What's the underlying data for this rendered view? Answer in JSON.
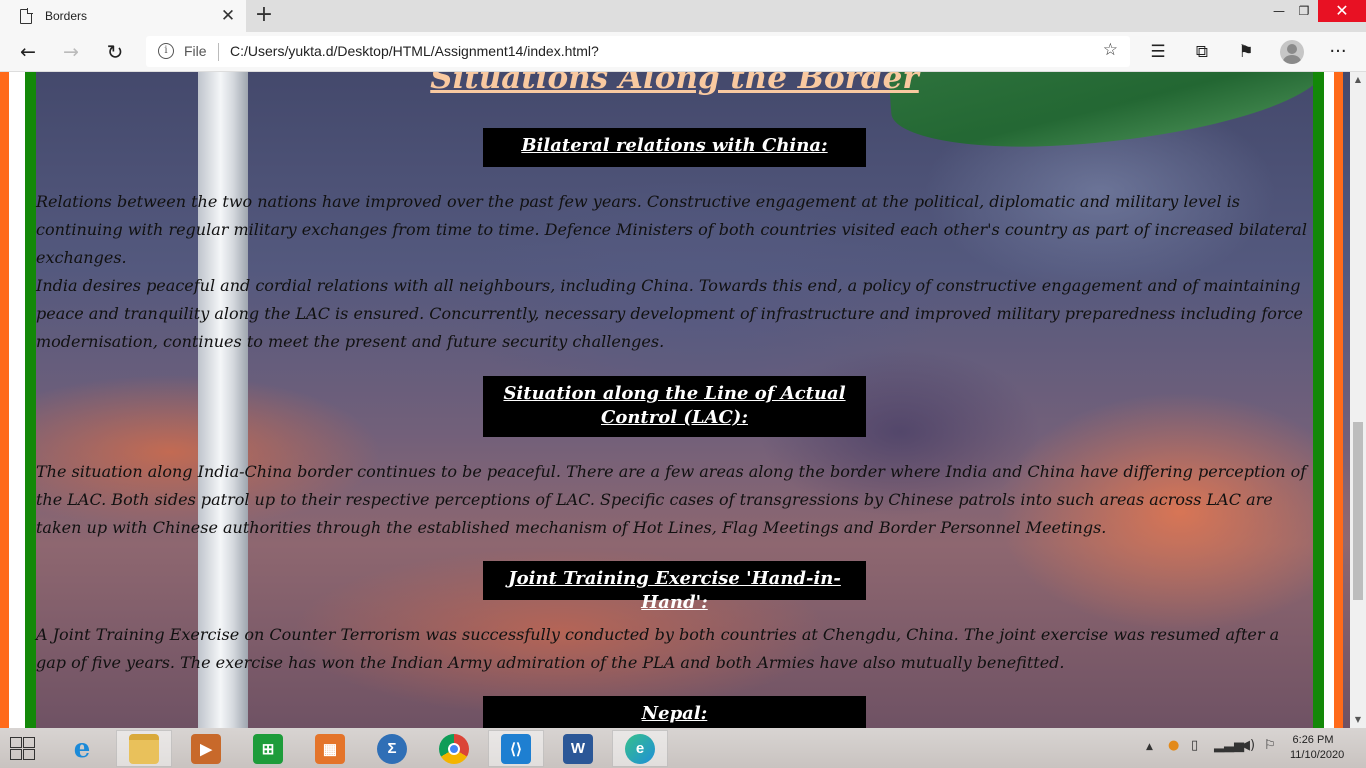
{
  "browser": {
    "tab_title": "Borders",
    "new_tab": "+",
    "url_scheme": "File",
    "url": "C:/Users/yukta.d/Desktop/HTML/Assignment14/index.html?"
  },
  "page": {
    "title": "Situations Along the Border",
    "sections": [
      {
        "heading": "Bilateral relations with China:",
        "paragraphs": [
          "Relations between the two nations have improved over the past few years. Constructive engagement at the political, diplomatic and military level is continuing with regular military exchanges from time to time. Defence Ministers of both countries visited each other's country as part of increased bilateral exchanges.",
          "India desires peaceful and cordial relations with all neighbours, including China. Towards this end, a policy of constructive engagement and of maintaining peace and tranquility along the LAC is ensured. Concurrently, necessary development of infrastructure and improved military preparedness including force modernisation, continues to meet the present and future security challenges."
        ]
      },
      {
        "heading": "Situation along the Line of Actual Control (LAC):",
        "paragraphs": [
          "The situation along India-China border continues to be peaceful. There are a few areas along the border where India and China have differing perception of the LAC. Both sides patrol up to their respective perceptions of LAC. Specific cases of transgressions by Chinese patrols into such areas across LAC are taken up with Chinese authorities through the established mechanism of Hot Lines, Flag Meetings and Border Personnel Meetings."
        ]
      },
      {
        "heading": "Joint Training Exercise 'Hand-in-Hand':",
        "paragraphs": [
          "A Joint Training Exercise on Counter Terrorism was successfully conducted by both countries at Chengdu, China. The joint exercise was resumed after a gap of five years. The exercise has won the Indian Army admiration of the PLA and both Armies have also mutually benefitted."
        ]
      },
      {
        "heading": "Nepal:",
        "paragraphs": []
      }
    ]
  },
  "taskbar": {
    "apps": [
      "internet-explorer",
      "file-explorer",
      "media-player",
      "store",
      "office",
      "math-input",
      "chrome",
      "vscode",
      "word",
      "edge"
    ],
    "clock_time": "6:26 PM",
    "clock_date": "11/10/2020"
  },
  "colors": {
    "saffron": "#ff6a1a",
    "green": "#138808",
    "title": "#f9c9a0",
    "heading_bg": "#000000"
  }
}
